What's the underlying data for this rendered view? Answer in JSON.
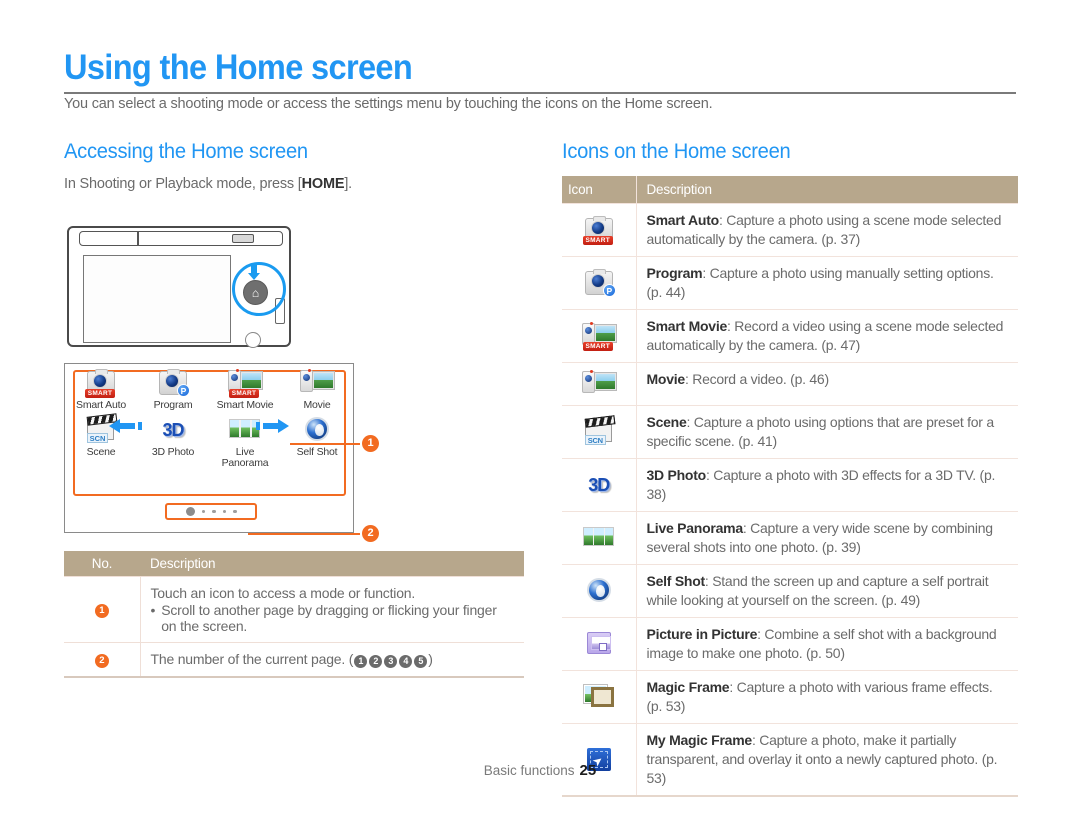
{
  "header": {
    "title": "Using the Home screen",
    "intro": "You can select a shooting mode or access the settings menu by touching the icons on the Home screen."
  },
  "left": {
    "section_title": "Accessing the Home screen",
    "instruction_prefix": "In Shooting or Playback mode, press [",
    "instruction_key": "HOME",
    "instruction_suffix": "].",
    "home_screen": {
      "modes": [
        {
          "label": "Smart Auto",
          "icon": "smart-auto-icon",
          "badge": "SMART"
        },
        {
          "label": "Program",
          "icon": "program-icon",
          "badge": "P"
        },
        {
          "label": "Smart Movie",
          "icon": "smart-movie-icon",
          "badge": "SMART"
        },
        {
          "label": "Movie",
          "icon": "movie-icon",
          "badge": ""
        },
        {
          "label": "Scene",
          "icon": "scene-icon",
          "badge": "SCN"
        },
        {
          "label": "3D Photo",
          "icon": "3d-photo-icon",
          "badge": "3D"
        },
        {
          "label": "Live\nPanorama",
          "icon": "live-panorama-icon",
          "badge": ""
        },
        {
          "label": "Self Shot",
          "icon": "self-shot-icon",
          "badge": ""
        }
      ],
      "page_dots": {
        "total": 5,
        "active": 1
      }
    },
    "callouts": [
      {
        "number": "1"
      },
      {
        "number": "2"
      }
    ],
    "table": {
      "headers": [
        "No.",
        "Description"
      ],
      "rows": [
        {
          "no": "1",
          "line1": "Touch an icon to access a mode or function.",
          "bullet": "Scroll to another page by dragging or flicking your finger on the screen."
        },
        {
          "no": "2",
          "line1_prefix": "The number of the current page. (",
          "page_numbers": [
            "1",
            "2",
            "3",
            "4",
            "5"
          ],
          "line1_suffix": ")"
        }
      ]
    }
  },
  "right": {
    "section_title": "Icons on the Home screen",
    "table": {
      "headers": [
        "Icon",
        "Description"
      ],
      "rows": [
        {
          "icon": "smart-auto-icon",
          "name": "Smart Auto",
          "desc": ": Capture a photo using a scene mode selected automatically by the camera. (p. 37)"
        },
        {
          "icon": "program-icon",
          "name": "Program",
          "desc": ": Capture a photo using manually setting options. (p. 44)"
        },
        {
          "icon": "smart-movie-icon",
          "name": "Smart Movie",
          "desc": ": Record a video using a scene mode selected automatically by the camera. (p. 47)"
        },
        {
          "icon": "movie-icon",
          "name": "Movie",
          "desc": ": Record a video. (p. 46)"
        },
        {
          "icon": "scene-icon",
          "name": "Scene",
          "desc": ": Capture a photo using options that are preset for a specific scene. (p. 41)"
        },
        {
          "icon": "3d-photo-icon",
          "name": "3D Photo",
          "desc": ": Capture a photo with 3D effects for a 3D TV. (p. 38)"
        },
        {
          "icon": "live-panorama-icon",
          "name": "Live Panorama",
          "desc": ": Capture a very wide scene by combining several shots into one photo. (p. 39)"
        },
        {
          "icon": "self-shot-icon",
          "name": "Self Shot",
          "desc": ": Stand the screen up and capture a self portrait while looking at yourself on the screen. (p. 49)"
        },
        {
          "icon": "picture-in-picture-icon",
          "name": "Picture in Picture",
          "desc": ": Combine a self shot with a background image to make one photo. (p. 50)"
        },
        {
          "icon": "magic-frame-icon",
          "name": "Magic Frame",
          "desc": ": Capture a photo with various frame effects. (p. 53)"
        },
        {
          "icon": "my-magic-frame-icon",
          "name": "My Magic Frame",
          "desc": ": Capture a photo, make it partially transparent, and overlay it onto a newly captured photo. (p. 53)"
        }
      ]
    }
  },
  "footer": {
    "section": "Basic functions",
    "page": "25"
  },
  "colors": {
    "accent_blue": "#2196f3",
    "callout_orange": "#f26b21",
    "table_header": "#b7a78c"
  }
}
